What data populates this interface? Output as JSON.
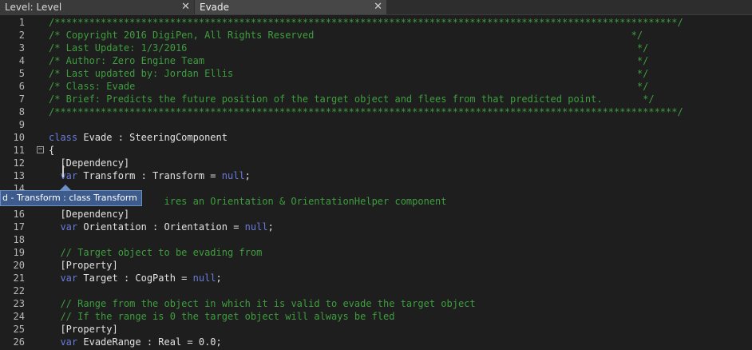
{
  "tabs": [
    {
      "label": "Level: Level",
      "close": "✕"
    },
    {
      "label": "Evade",
      "close": "✕"
    }
  ],
  "tooltip": "d - Transform : class Transform",
  "lines": [
    {
      "n": "1",
      "segments": [
        {
          "c": "comment",
          "t": "/************************************************************************************************************/"
        }
      ]
    },
    {
      "n": "2",
      "segments": [
        {
          "c": "comment",
          "t": "/* Copyright 2016 DigiPen, All Rights Reserved                                                       */"
        }
      ]
    },
    {
      "n": "3",
      "segments": [
        {
          "c": "comment",
          "t": "/* Last Update: 1/3/2016                                                                              */"
        }
      ]
    },
    {
      "n": "4",
      "segments": [
        {
          "c": "comment",
          "t": "/* Author: Zero Engine Team                                                                           */"
        }
      ]
    },
    {
      "n": "5",
      "segments": [
        {
          "c": "comment",
          "t": "/* Last updated by: Jordan Ellis                                                                      */"
        }
      ]
    },
    {
      "n": "6",
      "segments": [
        {
          "c": "comment",
          "t": "/* Class: Evade                                                                                       */"
        }
      ]
    },
    {
      "n": "7",
      "segments": [
        {
          "c": "comment",
          "t": "/* Brief: Predicts the future position of the target object and flees from that predicted point.       */"
        }
      ]
    },
    {
      "n": "8",
      "segments": [
        {
          "c": "comment",
          "t": "/************************************************************************************************************/"
        }
      ]
    },
    {
      "n": "9",
      "segments": []
    },
    {
      "n": "10",
      "segments": [
        {
          "c": "kw",
          "t": "class"
        },
        {
          "c": "txt",
          "t": " Evade : SteeringComponent"
        }
      ]
    },
    {
      "n": "11",
      "fold": "−",
      "segments": [
        {
          "c": "txt",
          "t": "{"
        }
      ]
    },
    {
      "n": "12",
      "segments": [
        {
          "c": "ws",
          "t": "  "
        },
        {
          "c": "txt",
          "t": "[Dependency]"
        }
      ]
    },
    {
      "n": "13",
      "segments": [
        {
          "c": "ws",
          "t": "  "
        },
        {
          "c": "kw",
          "t": "var"
        },
        {
          "c": "txt",
          "t": " Transform : Transform = "
        },
        {
          "c": "kw",
          "t": "null"
        },
        {
          "c": "txt",
          "t": ";"
        }
      ]
    },
    {
      "n": "14",
      "segments": []
    },
    {
      "n": "15",
      "segments": [
        {
          "c": "comment",
          "t": "                    ires an Orientation & OrientationHelper component"
        }
      ]
    },
    {
      "n": "16",
      "segments": [
        {
          "c": "ws",
          "t": "  "
        },
        {
          "c": "txt",
          "t": "[Dependency]"
        }
      ]
    },
    {
      "n": "17",
      "segments": [
        {
          "c": "ws",
          "t": "  "
        },
        {
          "c": "kw",
          "t": "var"
        },
        {
          "c": "txt",
          "t": " Orientation : Orientation = "
        },
        {
          "c": "kw",
          "t": "null"
        },
        {
          "c": "txt",
          "t": ";"
        }
      ]
    },
    {
      "n": "18",
      "segments": [
        {
          "c": "ws",
          "t": "  "
        }
      ]
    },
    {
      "n": "19",
      "segments": [
        {
          "c": "ws",
          "t": "  "
        },
        {
          "c": "comment",
          "t": "// Target object to be evading from"
        }
      ]
    },
    {
      "n": "20",
      "segments": [
        {
          "c": "ws",
          "t": "  "
        },
        {
          "c": "txt",
          "t": "[Property]"
        }
      ]
    },
    {
      "n": "21",
      "segments": [
        {
          "c": "ws",
          "t": "  "
        },
        {
          "c": "kw",
          "t": "var"
        },
        {
          "c": "txt",
          "t": " Target : CogPath = "
        },
        {
          "c": "kw",
          "t": "null"
        },
        {
          "c": "txt",
          "t": ";"
        }
      ]
    },
    {
      "n": "22",
      "segments": [
        {
          "c": "ws",
          "t": "  "
        }
      ]
    },
    {
      "n": "23",
      "segments": [
        {
          "c": "ws",
          "t": "  "
        },
        {
          "c": "comment",
          "t": "// Range from the object in which it is valid to evade the target object"
        }
      ]
    },
    {
      "n": "24",
      "segments": [
        {
          "c": "ws",
          "t": "  "
        },
        {
          "c": "comment",
          "t": "// If the range is 0 the target object will always be fled"
        }
      ]
    },
    {
      "n": "25",
      "segments": [
        {
          "c": "ws",
          "t": "  "
        },
        {
          "c": "txt",
          "t": "[Property]"
        }
      ]
    },
    {
      "n": "26",
      "segments": [
        {
          "c": "ws",
          "t": "  "
        },
        {
          "c": "kw",
          "t": "var"
        },
        {
          "c": "txt",
          "t": " EvadeRange : Real = 0.0;"
        }
      ]
    }
  ]
}
